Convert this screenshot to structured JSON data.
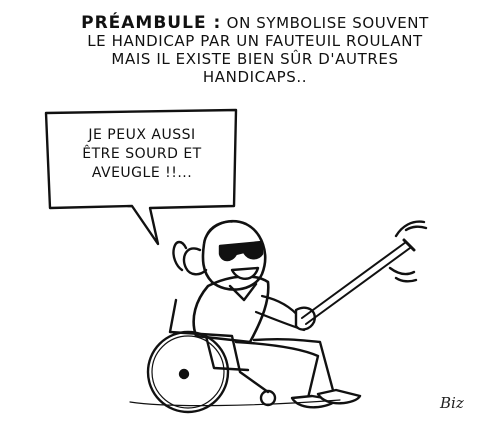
{
  "caption": {
    "lead": "Préambule :",
    "lines": [
      "on symbolise souvent",
      "le handicap par un fauteuil roulant",
      "mais il existe bien sûr d'autres",
      "handicaps.."
    ]
  },
  "speech_bubble": {
    "lines": [
      "Je peux aussi",
      "être sourd et",
      "aveugle !!..."
    ]
  },
  "signature": "Biz",
  "colors": {
    "ink": "#111111",
    "paper": "#ffffff"
  }
}
